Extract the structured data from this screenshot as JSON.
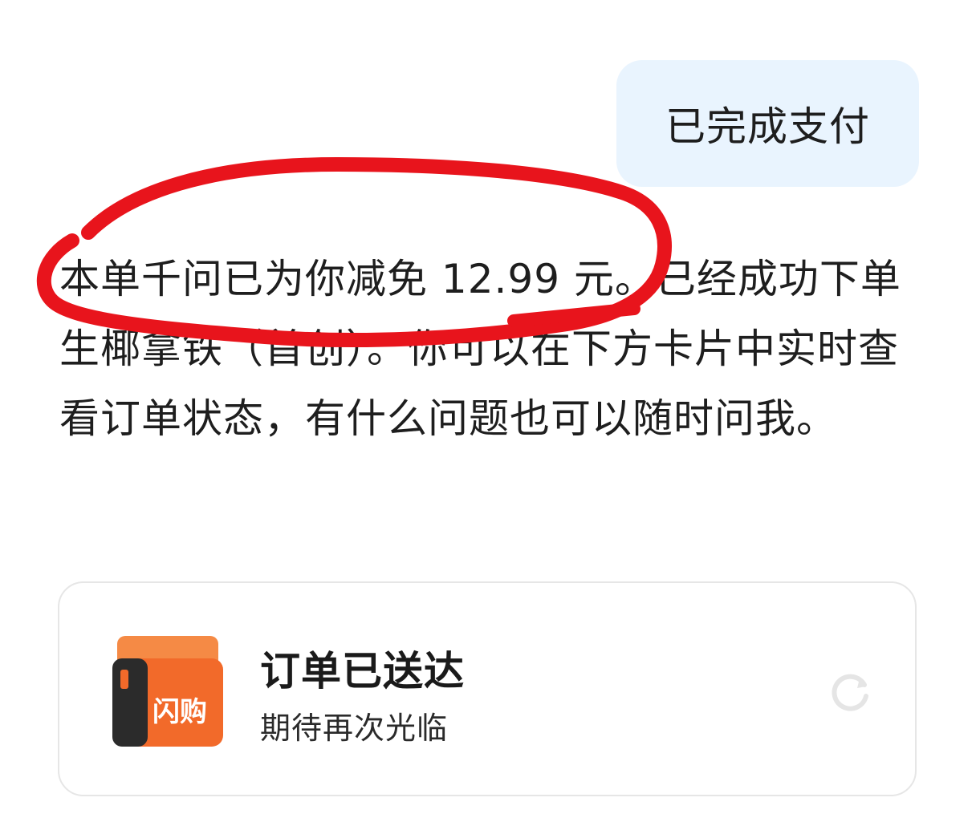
{
  "user_message": "已完成支付",
  "reply_text": "本单千问已为你减免 12.99 元。已经成功下单 生椰拿铁（首创）。你可以在下方卡片中实时查看订单状态，有什么问题也可以随时问我。",
  "order_card": {
    "title": "订单已送达",
    "subtitle": "期待再次光临",
    "icon_label": "闪购",
    "icon": "delivery-box-icon",
    "action_icon": "refresh-icon"
  },
  "colors": {
    "user_bubble": "#e9f4fe",
    "annotation": "#e8141c",
    "icon_orange": "#f26a2a"
  }
}
